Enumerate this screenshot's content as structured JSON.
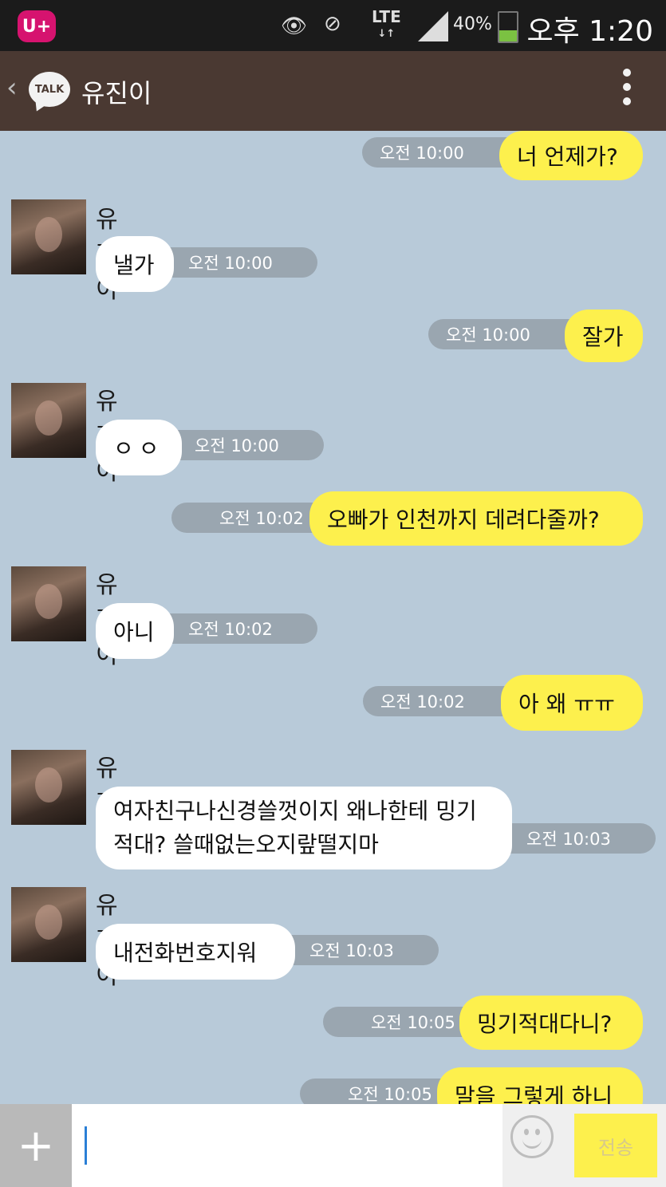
{
  "status_bar": {
    "carrier_logo": "U+",
    "icons": [
      "eye-icon",
      "mute-vibrate-icon",
      "lte-icon",
      "signal-icon",
      "battery-icon"
    ],
    "network": "LTE",
    "battery": "40%",
    "time": "오후 1:20"
  },
  "header": {
    "back_icon": "chevron-left-icon",
    "logo": "TALK",
    "title": "유진이",
    "menu_icon": "overflow-menu-icon"
  },
  "messages": [
    {
      "from": "me",
      "text": "너 언제가?",
      "time": "오전 10:00"
    },
    {
      "from": "them",
      "sender": "유진이",
      "text": "낼가",
      "time": "오전 10:00"
    },
    {
      "from": "me",
      "text": "잘가",
      "time": "오전 10:00"
    },
    {
      "from": "them",
      "sender": "유진이",
      "text": "ㅇㅇ",
      "time": "오전 10:00"
    },
    {
      "from": "me",
      "text": "오빠가 인천까지 데려다줄까?",
      "time": "오전 10:02"
    },
    {
      "from": "them",
      "sender": "유진이",
      "text": "아니",
      "time": "오전 10:02"
    },
    {
      "from": "me",
      "text": "아 왜 ㅠㅠ",
      "time": "오전 10:02"
    },
    {
      "from": "them",
      "sender": "유진이",
      "text": "여자친구나신경쓸껏이지 왜나한테 밍기적대? 쓸때없는오지랖떨지마",
      "time": "오전 10:03"
    },
    {
      "from": "them",
      "sender": "유진이",
      "text": "내전화번호지워",
      "time": "오전 10:03"
    },
    {
      "from": "me",
      "text": "밍기적대다니?",
      "time": "오전 10:05"
    },
    {
      "from": "me",
      "text": "말을 그렇게 하니",
      "time": "오전 10:05"
    }
  ],
  "input": {
    "plus_label": "+",
    "placeholder": "",
    "emoji_icon": "smiley-icon",
    "send_label": "전송"
  },
  "colors": {
    "chat_background": "#b8cad9",
    "header_background": "#4a3932",
    "my_bubble": "#fdf04d",
    "their_bubble": "#ffffff",
    "timestamp_pill": "#9aa6b0"
  }
}
